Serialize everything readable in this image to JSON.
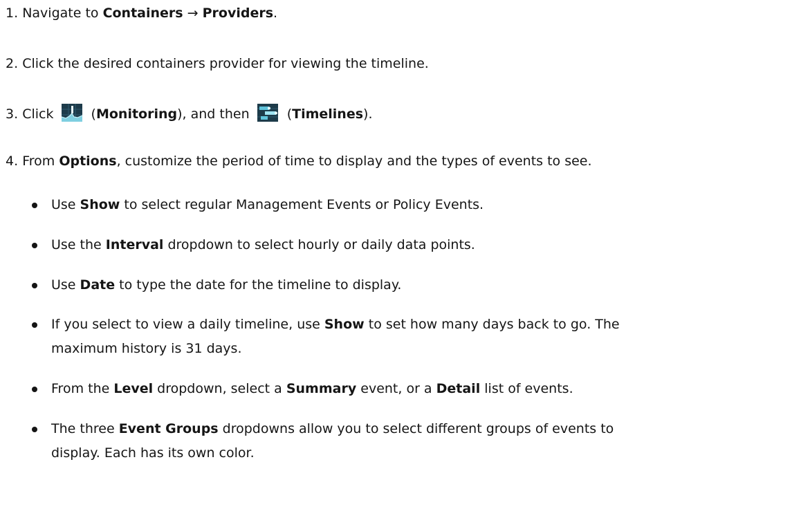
{
  "steps": [
    {
      "num": "1.",
      "t1": "Navigate to ",
      "b1": "Containers",
      "t2": " → ",
      "b2": "Providers",
      "t3": "."
    },
    {
      "num": "2.",
      "t1": "Click the desired containers provider for viewing the timeline."
    },
    {
      "num": "3.",
      "t1": "Click ",
      "t2": " (",
      "b1": "Monitoring",
      "t3": "), and then ",
      "t4": " (",
      "b2": "Timelines",
      "t5": ").",
      "icon1": "monitoring-icon",
      "icon2": "timelines-icon"
    },
    {
      "num": "4.",
      "t1": "From ",
      "b1": "Options",
      "t2": ", customize the period of time to display and the types of events to see."
    }
  ],
  "bullets": [
    {
      "t1": "Use ",
      "b1": "Show",
      "t2": " to select regular Management Events or Policy Events."
    },
    {
      "t1": "Use the ",
      "b1": "Interval",
      "t2": " dropdown to select hourly or daily data points."
    },
    {
      "t1": "Use ",
      "b1": "Date",
      "t2": " to type the date for the timeline to display."
    },
    {
      "t1": "If you select to view a daily timeline, use ",
      "b1": "Show",
      "t2": " to set how many days back to go. The",
      "line2": "maximum history is 31 days."
    },
    {
      "t1": "From the ",
      "b1": "Level",
      "t2": " dropdown, select a  ",
      "b2": "Summary",
      "t3": " event, or a  ",
      "b3": "Detail",
      "t4": " list of events."
    },
    {
      "t1": "The three ",
      "b1": "Event Groups",
      "t2": " dropdowns allow you to select different groups of events to",
      "line2": "display. Each has its own color."
    }
  ]
}
